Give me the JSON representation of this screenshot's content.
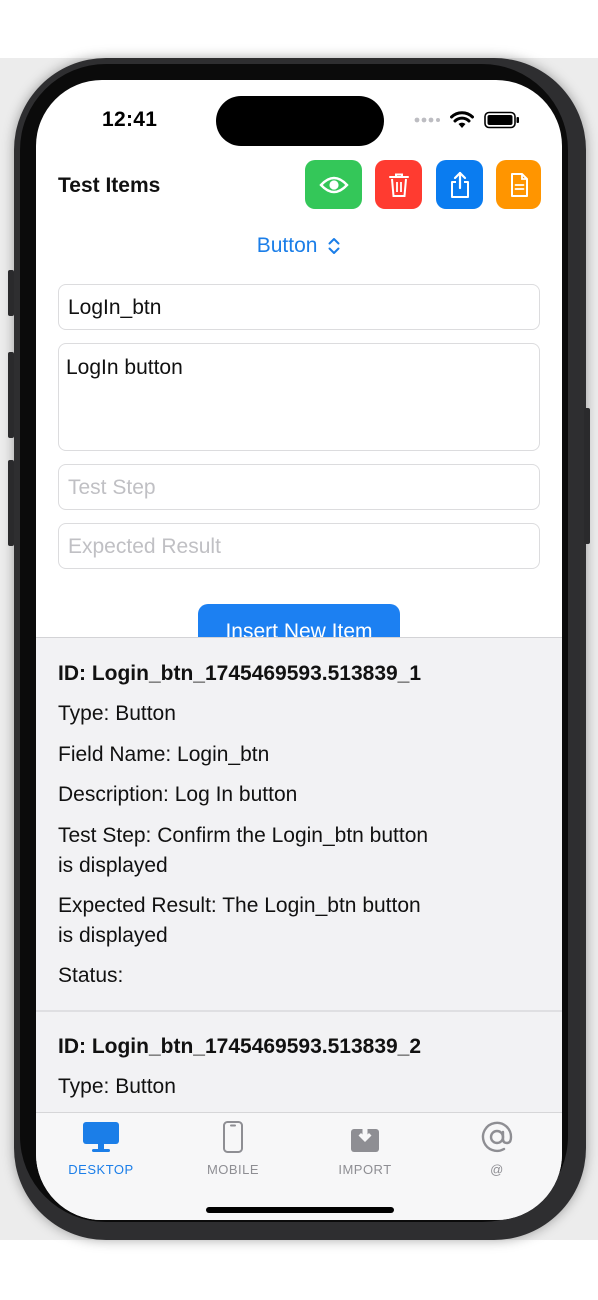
{
  "status_bar": {
    "time": "12:41"
  },
  "header": {
    "title": "Test Items",
    "buttons": [
      {
        "icon": "eye-icon",
        "color": "#34c759"
      },
      {
        "icon": "trash-icon",
        "color": "#ff3b30"
      },
      {
        "icon": "share-icon",
        "color": "#0a7cf0"
      },
      {
        "icon": "document-icon",
        "color": "#ff9500"
      }
    ]
  },
  "form": {
    "type_selected": "Button",
    "field_name_value": "LogIn_btn",
    "description_value": "LogIn button",
    "test_step_placeholder": "Test Step",
    "expected_result_placeholder": "Expected Result",
    "insert_label": "Insert New Item"
  },
  "items": [
    {
      "id": "ID: Login_btn_1745469593.513839_1",
      "type": "Type: Button",
      "field_name": "Field Name: Login_btn",
      "description": "Description: Log In button",
      "test_step_1": "Test Step: Confirm the Login_btn button",
      "test_step_2": "is displayed",
      "expected_1": "Expected Result: The Login_btn button",
      "expected_2": "is displayed",
      "status": "Status:"
    },
    {
      "id": "ID: Login_btn_1745469593.513839_2",
      "type": "Type: Button"
    }
  ],
  "tabs": [
    {
      "label": "DESKTOP",
      "icon": "desktop-icon",
      "active": true
    },
    {
      "label": "MOBILE",
      "icon": "mobile-phone-icon",
      "active": false
    },
    {
      "label": "IMPORT",
      "icon": "import-icon",
      "active": false
    },
    {
      "label": "@",
      "icon": "at-icon",
      "active": false
    }
  ],
  "colors": {
    "accent": "#1b7ee8",
    "insert_button": "#1c80f2"
  }
}
